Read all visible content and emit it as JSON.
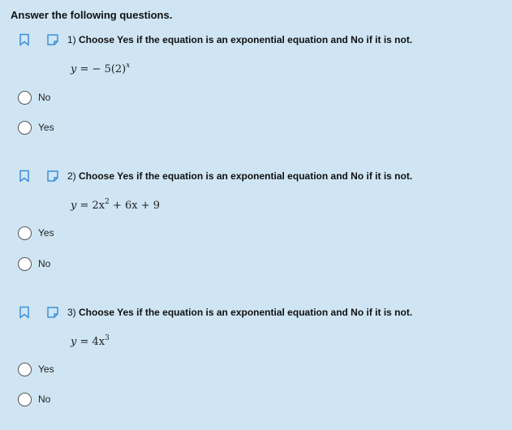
{
  "heading": "Answer the following questions.",
  "colors": {
    "accent": "#3d8fd6",
    "background": "#cfe5f3"
  },
  "icons": {
    "flag": "bookmark-icon",
    "note": "note-icon"
  },
  "questions": [
    {
      "number": "1)",
      "prompt": "Choose Yes if the equation is an exponential equation and No if it is not.",
      "equation": {
        "lhs": "y",
        "eq": " = ",
        "sign": "− ",
        "coef": "5(2)",
        "exp": "x",
        "rest": ""
      },
      "options": [
        {
          "label": "No"
        },
        {
          "label": "Yes"
        }
      ]
    },
    {
      "number": "2)",
      "prompt": "Choose Yes if the equation is an exponential equation and No if it is not.",
      "equation": {
        "lhs": "y",
        "eq": " = ",
        "sign": "",
        "coef": "2x",
        "exp": "2",
        "rest": " + 6x + 9"
      },
      "options": [
        {
          "label": "Yes"
        },
        {
          "label": "No"
        }
      ]
    },
    {
      "number": "3)",
      "prompt": "Choose Yes if the equation is an exponential equation and No if it is not.",
      "equation": {
        "lhs": "y",
        "eq": " = ",
        "sign": "",
        "coef": "4x",
        "exp": "3",
        "rest": ""
      },
      "options": [
        {
          "label": "Yes"
        },
        {
          "label": "No"
        }
      ]
    }
  ]
}
